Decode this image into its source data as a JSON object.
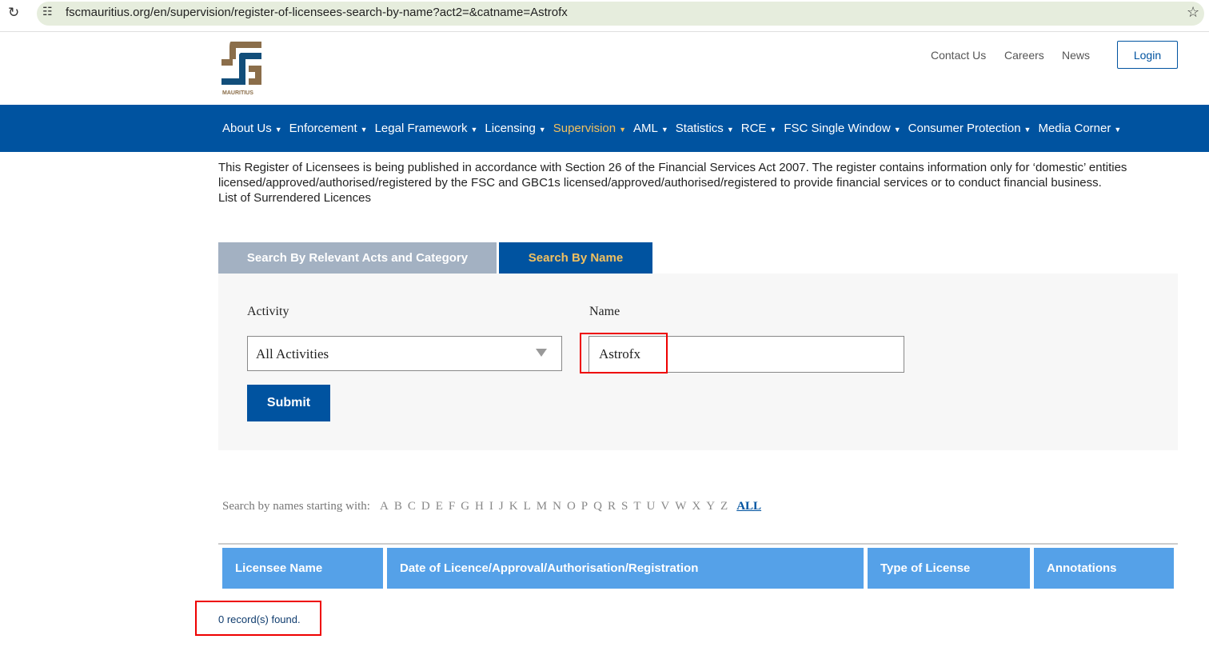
{
  "browser": {
    "url": "fscmauritius.org/en/supervision/register-of-licensees-search-by-name?act2=&catname=Astrofx",
    "reload_icon": "reload-icon",
    "star_icon": "star-icon"
  },
  "header": {
    "logo_text": "MAURITIUS",
    "links": [
      "Contact Us",
      "Careers",
      "News"
    ],
    "login": "Login"
  },
  "nav": {
    "items": [
      "About Us",
      "Enforcement",
      "Legal Framework",
      "Licensing",
      "Supervision",
      "AML",
      "Statistics",
      "RCE",
      "FSC Single Window",
      "Consumer Protection",
      "Media Corner"
    ],
    "active": "Supervision",
    "active_color": "#f0c060",
    "bg": "#0053a0"
  },
  "intro": {
    "text": "This Register of Licensees is being published in accordance with Section 26 of the Financial Services Act 2007. The register contains information only for ‘domestic’ entities licensed/approved/authorised/registered by the FSC and GBC1s licensed/approved/authorised/registered to provide financial services or to conduct financial business.",
    "link": "List of Surrendered Licences"
  },
  "tabs": {
    "category": "Search By Relevant Acts and Category",
    "name": "Search By Name"
  },
  "form": {
    "activity_label": "Activity",
    "activity_value": "All Activities",
    "name_label": "Name",
    "name_value": "Astrofx",
    "submit": "Submit"
  },
  "alphabet": {
    "label": "Search by names starting with:",
    "letters": [
      "A",
      "B",
      "C",
      "D",
      "E",
      "F",
      "G",
      "H",
      "I",
      "J",
      "K",
      "L",
      "M",
      "N",
      "O",
      "P",
      "Q",
      "R",
      "S",
      "T",
      "U",
      "V",
      "W",
      "X",
      "Y",
      "Z"
    ],
    "all": "ALL"
  },
  "table": {
    "headers": [
      "Licensee Name",
      "Date of Licence/Approval/Authorisation/Registration",
      "Type of License",
      "Annotations"
    ]
  },
  "results": {
    "text": "0 record(s) found."
  }
}
